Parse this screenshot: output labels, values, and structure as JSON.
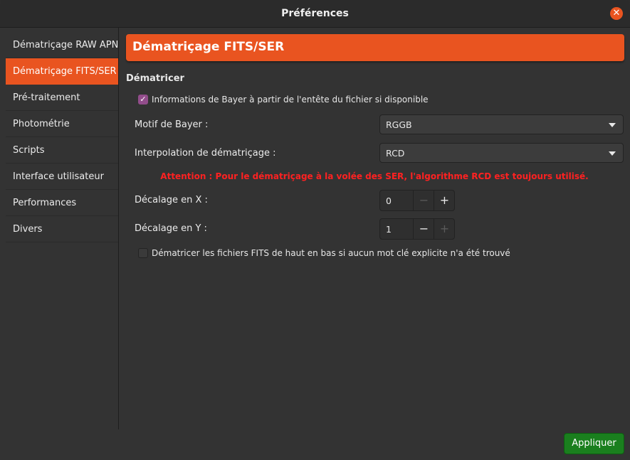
{
  "window": {
    "title": "Préférences",
    "close_icon": "close-icon",
    "accent_color": "#e95420"
  },
  "sidebar": {
    "items": [
      {
        "label": "Dématriçage RAW APN",
        "active": false
      },
      {
        "label": "Dématriçage FITS/SER",
        "active": true
      },
      {
        "label": "Pré-traitement",
        "active": false
      },
      {
        "label": "Photométrie",
        "active": false
      },
      {
        "label": "Scripts",
        "active": false
      },
      {
        "label": "Interface utilisateur",
        "active": false
      },
      {
        "label": "Performances",
        "active": false
      },
      {
        "label": "Divers",
        "active": false
      }
    ]
  },
  "main": {
    "header": "Dématriçage FITS/SER",
    "section": "Dématricer",
    "bayer_header_checkbox": {
      "label": "Informations de Bayer à partir de l'entête du fichier si disponible",
      "checked": true
    },
    "bayer_pattern": {
      "label": "Motif de Bayer :",
      "value": "RGGB"
    },
    "interpolation": {
      "label": "Interpolation de dématriçage :",
      "value": "RCD"
    },
    "warning": "Attention : Pour le dématriçage à la volée des SER, l'algorithme RCD est toujours utilisé.",
    "warning_color": "#ff2121",
    "offset_x": {
      "label": "Décalage en X :",
      "value": "0"
    },
    "offset_y": {
      "label": "Décalage en Y :",
      "value": "1"
    },
    "flip_checkbox": {
      "label": "Dématricer les fichiers FITS de haut en bas si aucun mot clé explicite n'a été trouvé",
      "checked": false
    }
  },
  "footer": {
    "apply_label": "Appliquer",
    "apply_color": "#1a7f1e"
  }
}
